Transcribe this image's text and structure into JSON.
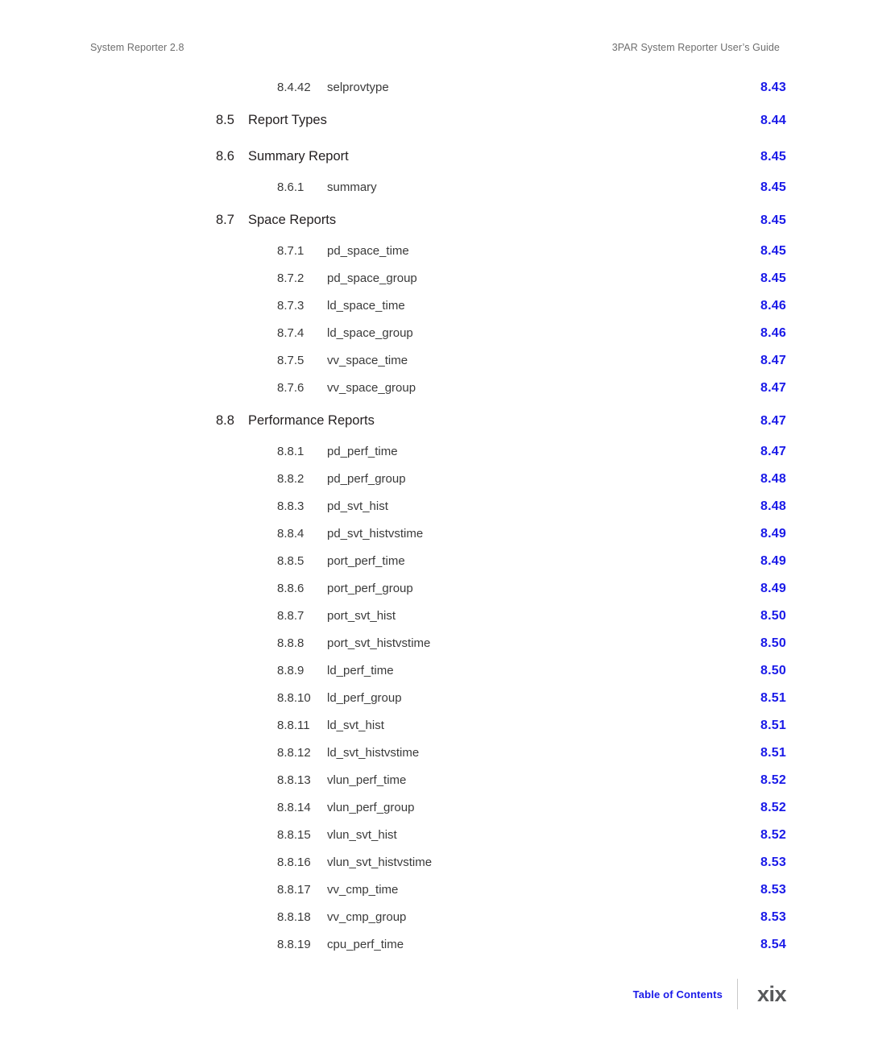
{
  "header": {
    "left": "System Reporter 2.8",
    "right": "3PAR System Reporter User’s Guide"
  },
  "colors": {
    "page_number": "#1a1ae8",
    "body_text": "#231f20",
    "header_text": "#6e6e6e",
    "folio_text": "#58595b",
    "divider": "#c9c9c9"
  },
  "toc": {
    "entries": [
      {
        "level": 2,
        "number": "8.4.42",
        "label": "selprovtype",
        "page": "8.43"
      },
      {
        "level": 1,
        "number": "8.5",
        "label": "Report Types",
        "page": "8.44"
      },
      {
        "level": 1,
        "number": "8.6",
        "label": "Summary Report",
        "page": "8.45"
      },
      {
        "level": 2,
        "number": "8.6.1",
        "label": "summary",
        "page": "8.45"
      },
      {
        "level": 1,
        "number": "8.7",
        "label": "Space Reports",
        "page": "8.45"
      },
      {
        "level": 2,
        "number": "8.7.1",
        "label": "pd_space_time",
        "page": "8.45"
      },
      {
        "level": 2,
        "number": "8.7.2",
        "label": "pd_space_group",
        "page": "8.45"
      },
      {
        "level": 2,
        "number": "8.7.3",
        "label": "ld_space_time",
        "page": "8.46"
      },
      {
        "level": 2,
        "number": "8.7.4",
        "label": "ld_space_group",
        "page": "8.46"
      },
      {
        "level": 2,
        "number": "8.7.5",
        "label": "vv_space_time",
        "page": "8.47"
      },
      {
        "level": 2,
        "number": "8.7.6",
        "label": "vv_space_group",
        "page": "8.47"
      },
      {
        "level": 1,
        "number": "8.8",
        "label": "Performance Reports",
        "page": "8.47"
      },
      {
        "level": 2,
        "number": "8.8.1",
        "label": "pd_perf_time",
        "page": "8.47"
      },
      {
        "level": 2,
        "number": "8.8.2",
        "label": "pd_perf_group",
        "page": "8.48"
      },
      {
        "level": 2,
        "number": "8.8.3",
        "label": "pd_svt_hist",
        "page": "8.48"
      },
      {
        "level": 2,
        "number": "8.8.4",
        "label": "pd_svt_histvstime",
        "page": "8.49"
      },
      {
        "level": 2,
        "number": "8.8.5",
        "label": "port_perf_time",
        "page": "8.49"
      },
      {
        "level": 2,
        "number": "8.8.6",
        "label": "port_perf_group",
        "page": "8.49"
      },
      {
        "level": 2,
        "number": "8.8.7",
        "label": "port_svt_hist",
        "page": "8.50"
      },
      {
        "level": 2,
        "number": "8.8.8",
        "label": "port_svt_histvstime",
        "page": "8.50"
      },
      {
        "level": 2,
        "number": "8.8.9",
        "label": "ld_perf_time",
        "page": "8.50"
      },
      {
        "level": 2,
        "number": "8.8.10",
        "label": "ld_perf_group",
        "page": "8.51"
      },
      {
        "level": 2,
        "number": "8.8.11",
        "label": "ld_svt_hist",
        "page": "8.51"
      },
      {
        "level": 2,
        "number": "8.8.12",
        "label": "ld_svt_histvstime",
        "page": "8.51"
      },
      {
        "level": 2,
        "number": "8.8.13",
        "label": "vlun_perf_time",
        "page": "8.52"
      },
      {
        "level": 2,
        "number": "8.8.14",
        "label": "vlun_perf_group",
        "page": "8.52"
      },
      {
        "level": 2,
        "number": "8.8.15",
        "label": "vlun_svt_hist",
        "page": "8.52"
      },
      {
        "level": 2,
        "number": "8.8.16",
        "label": "vlun_svt_histvstime",
        "page": "8.53"
      },
      {
        "level": 2,
        "number": "8.8.17",
        "label": "vv_cmp_time",
        "page": "8.53"
      },
      {
        "level": 2,
        "number": "8.8.18",
        "label": "vv_cmp_group",
        "page": "8.53"
      },
      {
        "level": 2,
        "number": "8.8.19",
        "label": "cpu_perf_time",
        "page": "8.54"
      }
    ]
  },
  "footer": {
    "label": "Table of Contents",
    "folio": "xix"
  }
}
